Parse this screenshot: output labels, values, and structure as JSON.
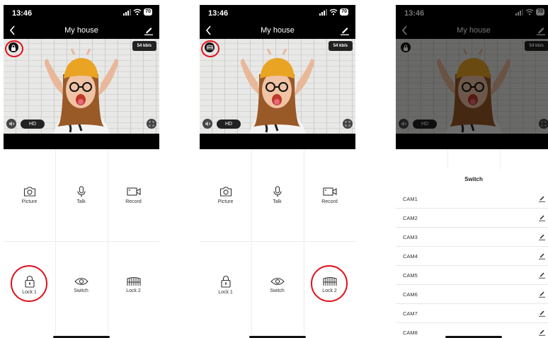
{
  "status": {
    "time": "13:46",
    "battery": "70"
  },
  "header": {
    "title": "My house"
  },
  "video": {
    "rate": "54 kb/s",
    "quality": "HD"
  },
  "controls": [
    {
      "label": "Picture",
      "icon": "camera-icon"
    },
    {
      "label": "Talk",
      "icon": "microphone-icon"
    },
    {
      "label": "Record",
      "icon": "video-camera-icon"
    },
    {
      "label": "Lock 1",
      "icon": "lock-icon"
    },
    {
      "label": "Switch",
      "icon": "eye-icon"
    },
    {
      "label": "Lock 2",
      "icon": "gate-icon"
    }
  ],
  "switch_sheet": {
    "title": "Switch",
    "cams": [
      "CAM1",
      "CAM2",
      "CAM3",
      "CAM4",
      "CAM5",
      "CAM6",
      "CAM7",
      "CAM8"
    ]
  },
  "colors": {
    "highlight": "#e0101a",
    "bar": "#000000"
  }
}
